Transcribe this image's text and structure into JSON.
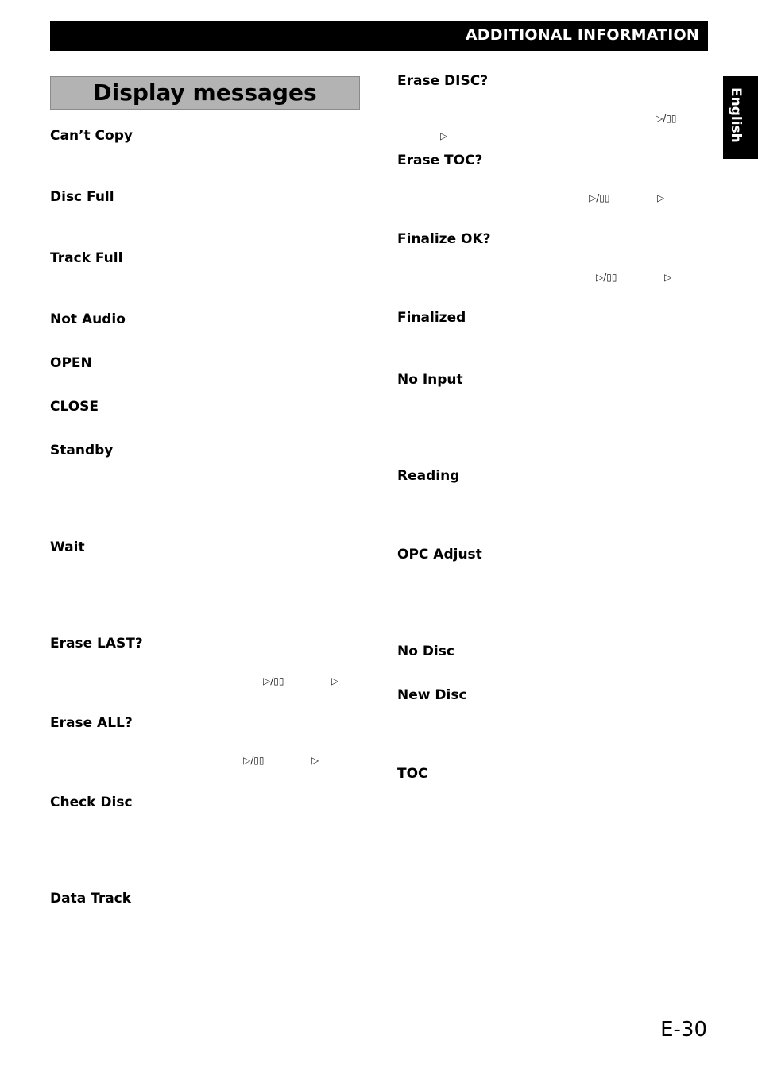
{
  "header": {
    "title": "ADDITIONAL INFORMATION"
  },
  "section": {
    "title": "Display messages"
  },
  "language_tab": {
    "label": "English"
  },
  "symbols": {
    "play_pause": "▷/▯▯",
    "play": "▷"
  },
  "left_column": [
    "Can’t Copy",
    "Disc Full",
    "Track Full",
    "Not Audio",
    "OPEN",
    "CLOSE",
    "Standby",
    "Wait",
    "Erase LAST?",
    "Erase ALL?",
    "Check Disc",
    "Data Track"
  ],
  "right_column": [
    "Erase DISC?",
    "Erase TOC?",
    "Finalize OK?",
    "Finalized",
    "No Input",
    "Reading",
    "OPC Adjust",
    "No Disc",
    "New Disc",
    "TOC"
  ],
  "footer": {
    "page_number": "E-30"
  }
}
